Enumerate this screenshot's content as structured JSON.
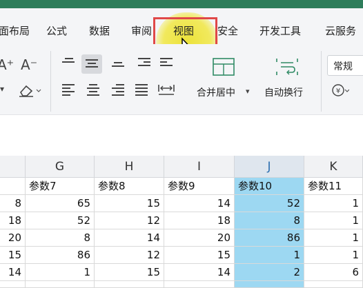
{
  "menu": {
    "tabs": [
      {
        "label": "面布局"
      },
      {
        "label": "公式"
      },
      {
        "label": "数据"
      },
      {
        "label": "审阅"
      },
      {
        "label": "视图"
      },
      {
        "label": "安全"
      },
      {
        "label": "开发工具"
      },
      {
        "label": "云服务"
      }
    ],
    "active_tab": "视图"
  },
  "ribbon": {
    "font_grow": "A⁺",
    "font_shrink": "A⁻",
    "merge_label": "合并居中",
    "wrap_label": "自动换行",
    "style_value": "常规",
    "currency_symbol": "¥"
  },
  "grid": {
    "columns": [
      "G",
      "H",
      "I",
      "J",
      "K"
    ],
    "selected_column": "J",
    "header_row": [
      "",
      "参数7",
      "参数8",
      "参数9",
      "参数10",
      "参数11"
    ],
    "rows": [
      [
        "8",
        "65",
        "15",
        "14",
        "52",
        "1"
      ],
      [
        "18",
        "52",
        "12",
        "18",
        "8",
        "1"
      ],
      [
        "20",
        "8",
        "14",
        "20",
        "86",
        "1"
      ],
      [
        "15",
        "86",
        "12",
        "15",
        "1",
        "1"
      ],
      [
        "14",
        "1",
        "15",
        "14",
        "2",
        "6"
      ],
      [
        "",
        "",
        "",
        "",
        "",
        ""
      ]
    ]
  },
  "colors": {
    "accent_green": "#2e7d5b",
    "highlight_yellow": "#ece23a",
    "annotation_red": "#e04848",
    "selection_blue": "#9dd8f2"
  }
}
